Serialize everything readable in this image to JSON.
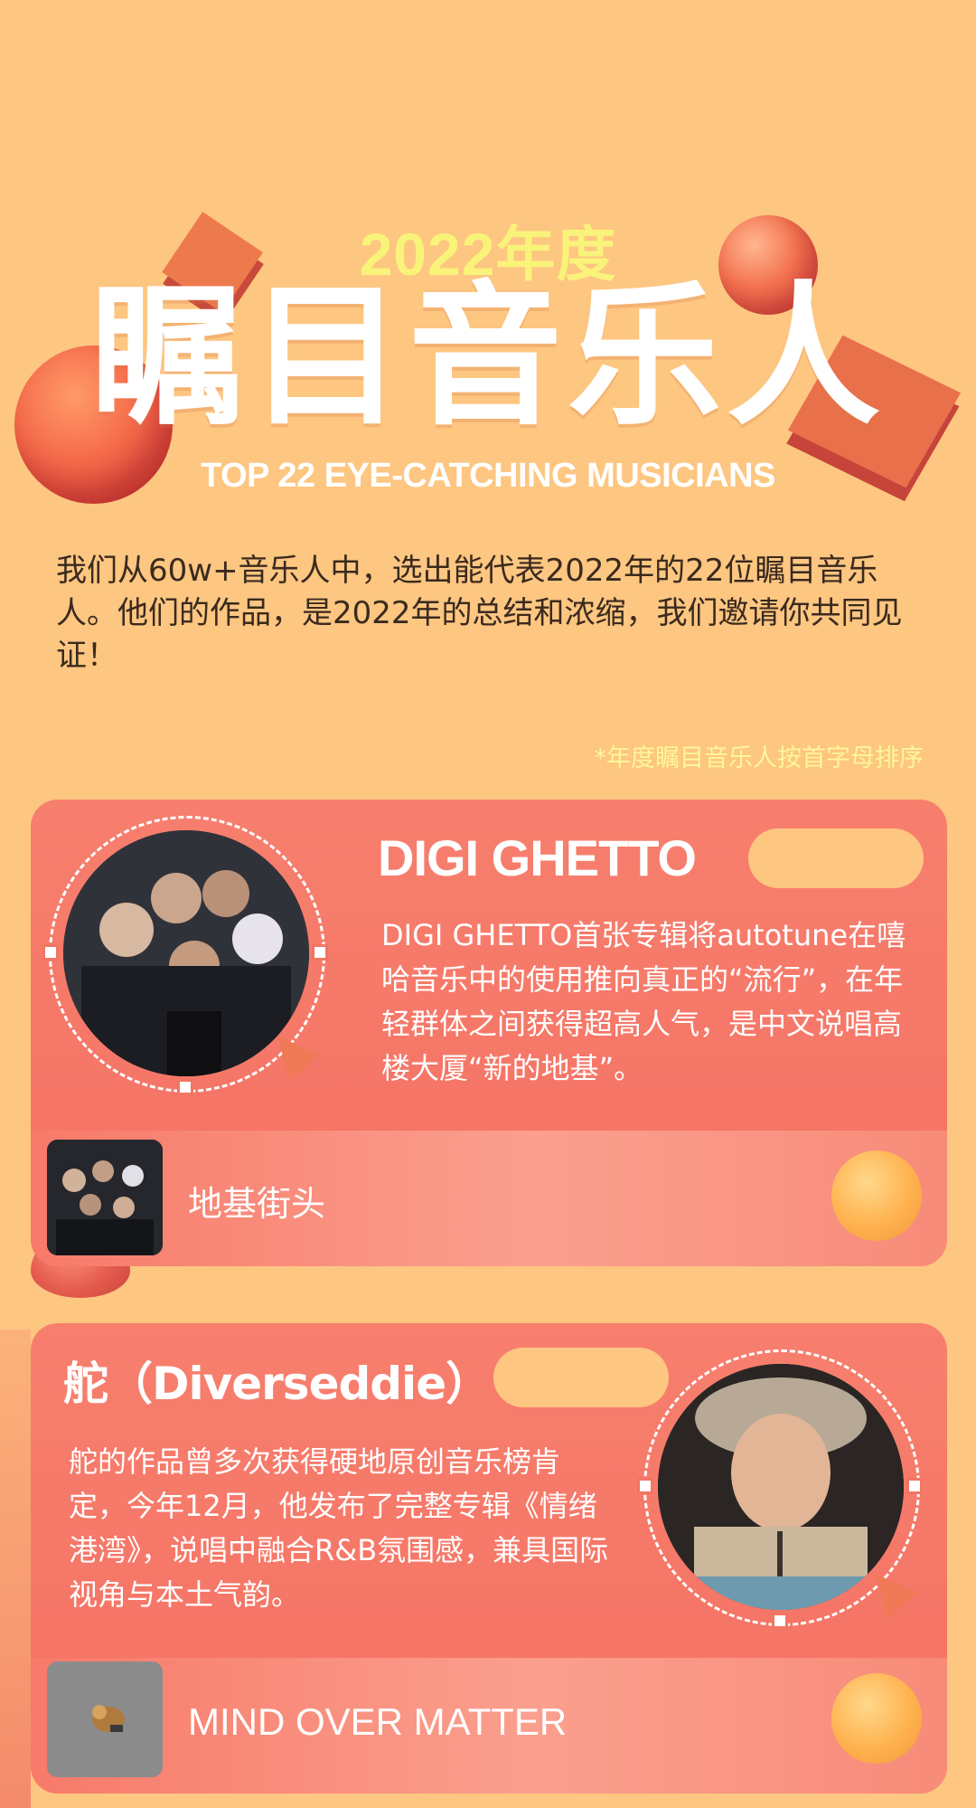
{
  "header": {
    "year": "2022年度",
    "title": "瞩目音乐人",
    "subtitle": "TOP 22 EYE-CATCHING MUSICIANS",
    "intro": "我们从60w+音乐人中，选出能代表2022年的22位瞩目音乐人。他们的作品，是2022年的总结和浓缩，我们邀请你共同见证！",
    "note": "*年度瞩目音乐人按首字母排序"
  },
  "musicians": [
    {
      "name": "DIGI GHETTO",
      "description": "DIGI GHETTO首张专辑将autotune在嘻哈音乐中的使用推向真正的“流行”，在年轻群体之间获得超高人气，是中文说唱高楼大厦“新的地基”。",
      "song": "地基街头"
    },
    {
      "name": "舵（Diverseddie）",
      "description": "舵的作品曾多次获得硬地原创音乐榜肯定，今年12月，他发布了完整专辑《情绪港湾》，说唱中融合R&B氛围感，兼具国际视角与本土气韵。",
      "song": "MIND OVER MATTER"
    }
  ],
  "icons": {
    "play": "play-orb-icon",
    "cursor": "pointer-cursor-icon"
  },
  "colors": {
    "background": "#fdc681",
    "card": "#f47163",
    "year": "#f9f37a",
    "accent_pill": "#fdc681"
  }
}
